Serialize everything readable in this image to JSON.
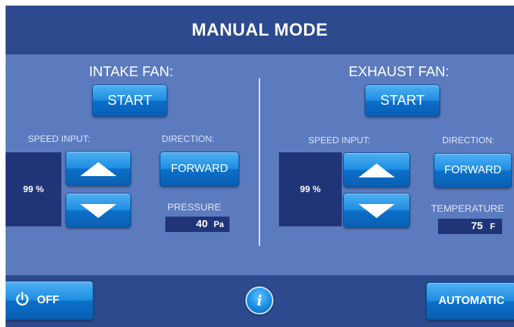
{
  "header": {
    "title": "MANUAL MODE"
  },
  "intake": {
    "heading": "INTAKE FAN:",
    "start_label": "START",
    "speed_label": "SPEED INPUT:",
    "speed_value": "99 %",
    "direction_label": "DIRECTION:",
    "direction_value": "FORWARD",
    "sensor_label": "PRESSURE",
    "sensor_value": "40",
    "sensor_unit": "Pa"
  },
  "exhaust": {
    "heading": "EXHAUST FAN:",
    "start_label": "START",
    "speed_label": "SPEED INPUT:",
    "speed_value": "99 %",
    "direction_label": "DIRECTION:",
    "direction_value": "FORWARD",
    "sensor_label": "TEMPERATURE",
    "sensor_value": "75",
    "sensor_unit": "F"
  },
  "footer": {
    "off_label": "OFF",
    "info_icon": "i",
    "automatic_label": "AUTOMATIC"
  },
  "icons": {
    "power": "power-icon",
    "info": "info-icon",
    "up": "arrow-up-icon",
    "down": "arrow-down-icon"
  },
  "colors": {
    "header_bg": "#2d4a8e",
    "panel_bg": "#5c7bbf",
    "readout_bg": "#1f3577",
    "button_blue": "#1f8ee3"
  }
}
